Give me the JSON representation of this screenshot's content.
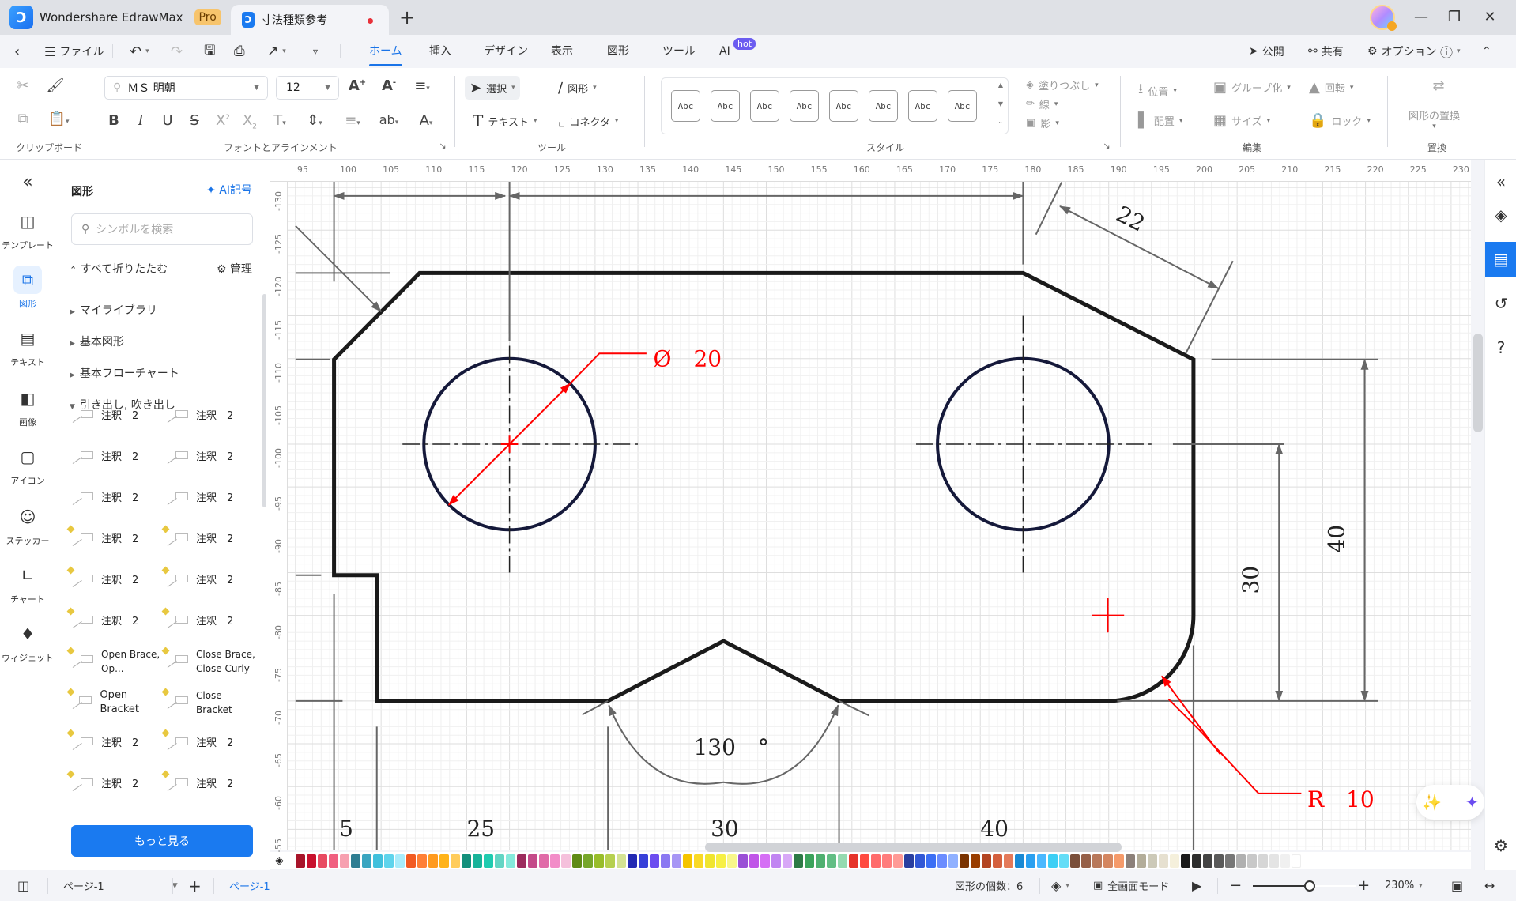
{
  "app": {
    "name": "Wondershare EdrawMax",
    "badge": "Pro",
    "document_tab": "寸法種類参考",
    "new_tab_icon": "plus-icon"
  },
  "window_controls": [
    "minimize-icon",
    "restore-icon",
    "close-icon"
  ],
  "menubar": {
    "back_icon": "chevron-left-icon",
    "file_label": "ファイル",
    "tabs": [
      {
        "label": "ホーム",
        "active": true
      },
      {
        "label": "挿入"
      },
      {
        "label": "デザイン"
      },
      {
        "label": "表示"
      },
      {
        "label": "図形"
      },
      {
        "label": "ツール"
      },
      {
        "label": "AI",
        "badge": "hot"
      }
    ],
    "right": {
      "publish": "公開",
      "share": "共有",
      "options": "オプション"
    }
  },
  "ribbon": {
    "groups": {
      "clipboard": "クリップボード",
      "font": "フォントとアラインメント",
      "tools": "ツール",
      "style": "スタイル",
      "edit": "編集",
      "replace": "置換"
    },
    "font_name": "ＭＳ 明朝",
    "font_size": "12",
    "tools": {
      "select": "選択",
      "shape": "図形",
      "text": "テキスト",
      "connector": "コネクタ"
    },
    "style_preview": "Abc",
    "style_count": 8,
    "format": {
      "fill": "塗りつぶし",
      "line": "線",
      "shadow": "影"
    },
    "edit": {
      "position": "位置",
      "group": "グループ化",
      "rotate": "回転",
      "align": "配置",
      "size": "サイズ",
      "lock": "ロック"
    },
    "replace_shape": "図形の置換"
  },
  "leftnav": {
    "collapse_icon": "double-chevron-left-icon",
    "items": [
      {
        "label": "テンプレート",
        "icon": "template-icon"
      },
      {
        "label": "図形",
        "icon": "shapes-icon",
        "active": true
      },
      {
        "label": "テキスト",
        "icon": "text-icon"
      },
      {
        "label": "画像",
        "icon": "image-icon"
      },
      {
        "label": "アイコン",
        "icon": "icon-library-icon"
      },
      {
        "label": "ステッカー",
        "icon": "sticker-icon"
      },
      {
        "label": "チャート",
        "icon": "chart-icon"
      },
      {
        "label": "ウィジェット",
        "icon": "widget-icon"
      }
    ]
  },
  "panel": {
    "title": "図形",
    "ai_symbol": "AI記号",
    "search_placeholder": "シンボルを検索",
    "collapse_all": "すべて折りたたむ",
    "manage": "管理",
    "categories": [
      {
        "label": "マイライブラリ",
        "expanded": false
      },
      {
        "label": "基本図形",
        "expanded": false
      },
      {
        "label": "基本フローチャート",
        "expanded": false
      },
      {
        "label": "引き出し, 吹き出し",
        "expanded": true
      }
    ],
    "shapes": [
      {
        "label": "注釈　2"
      },
      {
        "label": "注釈　2"
      },
      {
        "label": "注釈　2"
      },
      {
        "label": "注釈　2"
      },
      {
        "label": "注釈　2"
      },
      {
        "label": "注釈　2"
      },
      {
        "label": "注釈　2"
      },
      {
        "label": "注釈　2"
      },
      {
        "label": "注釈　2"
      },
      {
        "label": "注釈　2"
      },
      {
        "label": "注釈　2"
      },
      {
        "label": "注釈　2"
      },
      {
        "label": "Open Brace, Op..."
      },
      {
        "label": "Close Brace, Close Curly"
      },
      {
        "label": "Open Bracket"
      },
      {
        "label": "Close Bracket"
      },
      {
        "label": "注釈　2"
      },
      {
        "label": "注釈　2"
      },
      {
        "label": "注釈　2"
      },
      {
        "label": "注釈　2"
      }
    ],
    "more_button": "もっと見る"
  },
  "rulers": {
    "top": [
      "95",
      "100",
      "105",
      "110",
      "115",
      "120",
      "125",
      "130",
      "135",
      "140",
      "145",
      "150",
      "155",
      "160",
      "165",
      "170",
      "175",
      "180",
      "185",
      "190",
      "195",
      "200",
      "205",
      "210",
      "215",
      "220",
      "225",
      "230"
    ],
    "left": [
      "-130",
      "-125",
      "-120",
      "-115",
      "-110",
      "-105",
      "-100",
      "-95",
      "-90",
      "-85",
      "-80",
      "-75",
      "-70",
      "-65",
      "-60",
      "-55"
    ]
  },
  "drawing": {
    "dimensions": {
      "chamfer_length": "22",
      "hole_diameter": "Ø　20",
      "height_outer": "40",
      "height_inner": "30",
      "angle": "130　°",
      "fillet_radius": "R　10",
      "bottom_partial": [
        "5",
        "25",
        "30",
        "40"
      ]
    },
    "colors": {
      "outline": "#1a1a1a",
      "circles": "#15193a",
      "dim_lines": "#666666",
      "annotations": "#ff0000"
    }
  },
  "right_panel": {
    "items": [
      "double-chevron-left-icon",
      "fill-bucket-icon",
      "page-properties-icon",
      "history-icon",
      "help-icon"
    ],
    "active_index": 2
  },
  "colorbar": {
    "swatches": [
      "#a8142a",
      "#c8102e",
      "#e84a62",
      "#f05f80",
      "#f7a0b0",
      "#2e7d92",
      "#3aa5c0",
      "#40c0dc",
      "#5fd4ec",
      "#a8ecfb",
      "#f25a22",
      "#ff7f36",
      "#ff9a1f",
      "#ffb31a",
      "#ffcc5c",
      "#128f7c",
      "#17b39a",
      "#1fcbb0",
      "#63d5c4",
      "#85eadc",
      "#9c2b5e",
      "#c44a8a",
      "#e06aa8",
      "#f28cc8",
      "#f5c0dc",
      "#5f8a15",
      "#76a62a",
      "#98bd2a",
      "#b5d04f",
      "#d3e293",
      "#2229b3",
      "#3740d9",
      "#6b4cf0",
      "#8a78f2",
      "#a796f5",
      "#f5c400",
      "#f9d926",
      "#f0e52e",
      "#f7f043",
      "#f8f78a",
      "#9a4fd6",
      "#c055e8",
      "#d56ff5",
      "#c185f2",
      "#d8a8f7",
      "#2d7a46",
      "#3ba35b",
      "#4fb070",
      "#62be84",
      "#95dab0",
      "#e6332a",
      "#ff4a40",
      "#ff6b6b",
      "#ff7c7c",
      "#ff9a96",
      "#2a3fa0",
      "#3258d6",
      "#3c6ff5",
      "#6a8cff",
      "#8fb0ff",
      "#7a3300",
      "#993d00",
      "#b34522",
      "#d4603e",
      "#e47a5a",
      "#1a8ad4",
      "#2aa0f0",
      "#4ab8ff",
      "#3ccff5",
      "#63ddf7",
      "#7a4f3a",
      "#966048",
      "#b8785a",
      "#d48660",
      "#f59a6a",
      "#8c807a",
      "#b3ad9a",
      "#ccc9b8",
      "#e6e0d0",
      "#f5f0dc",
      "#1a1a1a",
      "#2e2e2e",
      "#444444",
      "#5a5a5a",
      "#777777",
      "#b0b0b0",
      "#c8c8c8",
      "#d6d6d6",
      "#e4e4e4",
      "#f0f0f0",
      "#ffffff"
    ]
  },
  "statusbar": {
    "page_selector": "ページ-1",
    "current_page_tab": "ページ-1",
    "shape_count": "図形の個数：6",
    "fullscreen": "全画面モード",
    "zoom_value": "230%",
    "zoom_fraction": 0.55
  },
  "accent_color": "#1a74e8"
}
